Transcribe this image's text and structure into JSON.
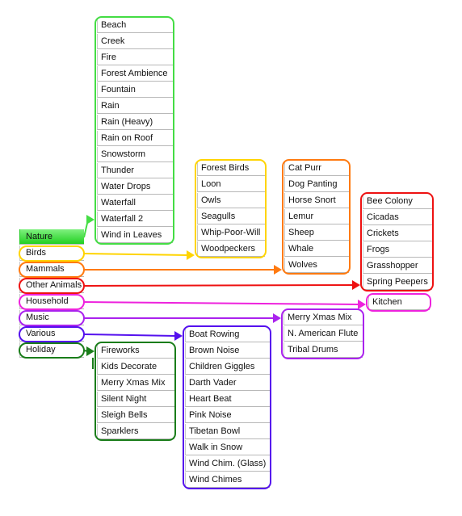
{
  "categories": [
    {
      "label": "Nature",
      "color": "#44dd44",
      "selected": true
    },
    {
      "label": "Birds",
      "color": "#ffd400"
    },
    {
      "label": "Mammals",
      "color": "#ff7a10"
    },
    {
      "label": "Other Animals",
      "color": "#ee1111"
    },
    {
      "label": "Household",
      "color": "#ee22dd"
    },
    {
      "label": "Music",
      "color": "#aa22ee"
    },
    {
      "label": "Various",
      "color": "#5511ee"
    },
    {
      "label": "Holiday",
      "color": "#1a7d1a"
    }
  ],
  "lists": {
    "nature": [
      "Beach",
      "Creek",
      "Fire",
      "Forest Ambience",
      "Fountain",
      "Rain",
      "Rain (Heavy)",
      "Rain on Roof",
      "Snowstorm",
      "Thunder",
      "Water Drops",
      "Waterfall",
      "Waterfall 2",
      "Wind in Leaves"
    ],
    "birds": [
      "Forest Birds",
      "Loon",
      "Owls",
      "Seagulls",
      "Whip-Poor-Will",
      "Woodpeckers"
    ],
    "mammals": [
      "Cat Purr",
      "Dog Panting",
      "Horse Snort",
      "Lemur",
      "Sheep",
      "Whale",
      "Wolves"
    ],
    "other_animals": [
      "Bee Colony",
      "Cicadas",
      "Crickets",
      "Frogs",
      "Grasshopper",
      "Spring Peepers"
    ],
    "household": [
      "Kitchen"
    ],
    "music": [
      "Merry Xmas Mix",
      "N. American Flute",
      "Tribal Drums"
    ],
    "various": [
      "Boat Rowing",
      "Brown Noise",
      "Children Giggles",
      "Darth Vader",
      "Heart Beat",
      "Pink Noise",
      "Tibetan Bowl",
      "Walk in Snow",
      "Wind Chim. (Glass)",
      "Wind Chimes"
    ],
    "holiday": [
      "Fireworks",
      "Kids Decorate",
      "Merry Xmas Mix",
      "Silent Night",
      "Sleigh Bells",
      "Sparklers"
    ]
  }
}
